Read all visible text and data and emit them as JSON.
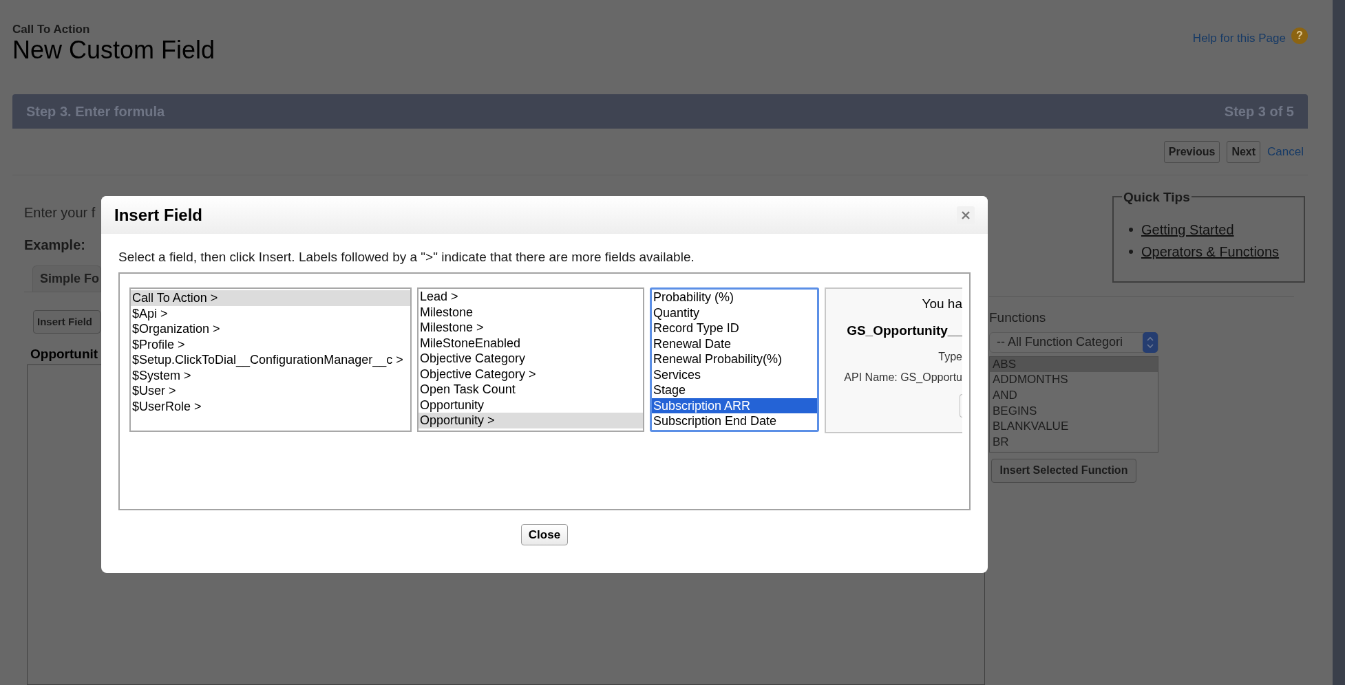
{
  "page": {
    "breadcrumb": "Call To Action",
    "title": "New Custom Field",
    "help_link": "Help for this Page",
    "help_icon": "?"
  },
  "step": {
    "title": "Step 3. Enter formula",
    "counter": "Step 3 of 5"
  },
  "nav_buttons": [
    "Previous",
    "Next"
  ],
  "cancel_link": "Cancel",
  "formula": {
    "intro": "Enter your f",
    "example_label": "Example:",
    "tab": "Simple Fo",
    "insert_field_button": "Insert Field",
    "field_label": "Opportunit"
  },
  "quick_tips": {
    "title": "Quick Tips",
    "links": [
      "Getting Started",
      "Operators & Functions"
    ]
  },
  "functions": {
    "label": "Functions",
    "category": "-- All Function Categori",
    "button": "Insert Selected Function",
    "items": [
      {
        "label": "ABS",
        "selected": true
      },
      {
        "label": "ADDMONTHS",
        "selected": false
      },
      {
        "label": "AND",
        "selected": false
      },
      {
        "label": "BEGINS",
        "selected": false
      },
      {
        "label": "BLANKVALUE",
        "selected": false
      },
      {
        "label": "BR",
        "selected": false
      }
    ]
  },
  "dialog": {
    "title": "Insert Field",
    "description": "Select a field, then click Insert. Labels followed by a \">\" indicate that there are more fields available.",
    "close_button": "Close",
    "lists": [
      {
        "focused": false,
        "items": [
          {
            "label": "Call To Action >",
            "selected": true
          },
          {
            "label": "$Api >",
            "selected": false
          },
          {
            "label": "$Organization >",
            "selected": false
          },
          {
            "label": "$Profile >",
            "selected": false
          },
          {
            "label": "$Setup.ClickToDial__ConfigurationManager__c >",
            "selected": false
          },
          {
            "label": "$System >",
            "selected": false
          },
          {
            "label": "$User >",
            "selected": false
          },
          {
            "label": "$UserRole >",
            "selected": false
          }
        ]
      },
      {
        "focused": false,
        "items": [
          {
            "label": "Lead >",
            "selected": false
          },
          {
            "label": "Milestone",
            "selected": false
          },
          {
            "label": "Milestone >",
            "selected": false
          },
          {
            "label": "MileStoneEnabled",
            "selected": false
          },
          {
            "label": "Objective Category",
            "selected": false
          },
          {
            "label": "Objective Category >",
            "selected": false
          },
          {
            "label": "Open Task Count",
            "selected": false
          },
          {
            "label": "Opportunity",
            "selected": false
          },
          {
            "label": "Opportunity >",
            "selected": true
          }
        ]
      },
      {
        "focused": true,
        "items": [
          {
            "label": "Probability (%)",
            "selected": false
          },
          {
            "label": "Quantity",
            "selected": false
          },
          {
            "label": "Record Type ID",
            "selected": false
          },
          {
            "label": "Renewal Date",
            "selected": false
          },
          {
            "label": "Renewal Probability(%)",
            "selected": false
          },
          {
            "label": "Services",
            "selected": false
          },
          {
            "label": "Stage",
            "selected": false
          },
          {
            "label": "Subscription ARR",
            "selected": true
          },
          {
            "label": "Subscription End Date",
            "selected": false
          }
        ]
      }
    ],
    "preview": {
      "notice": "You ha",
      "field_name": "GS_Opportunity__",
      "type_label": "Type",
      "api_name": "API Name: GS_Opportu"
    }
  }
}
